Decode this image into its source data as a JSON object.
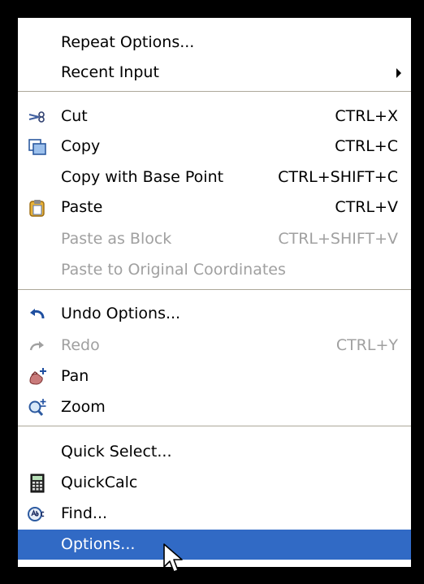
{
  "menu": {
    "repeat_options": "Repeat Options...",
    "recent_input": "Recent Input",
    "cut": "Cut",
    "cut_shortcut": "CTRL+X",
    "copy": "Copy",
    "copy_shortcut": "CTRL+C",
    "copy_base": "Copy with Base Point",
    "copy_base_shortcut": "CTRL+SHIFT+C",
    "paste": "Paste",
    "paste_shortcut": "CTRL+V",
    "paste_block": "Paste as Block",
    "paste_block_shortcut": "CTRL+SHIFT+V",
    "paste_original": "Paste to Original Coordinates",
    "undo_options": "Undo Options...",
    "redo": "Redo",
    "redo_shortcut": "CTRL+Y",
    "pan": "Pan",
    "zoom": "Zoom",
    "quick_select": "Quick Select...",
    "quickcalc": "QuickCalc",
    "find": "Find...",
    "options": "Options..."
  },
  "colors": {
    "selection": "#316ac5",
    "disabled_text": "#a0a0a0",
    "background": "#000000"
  }
}
